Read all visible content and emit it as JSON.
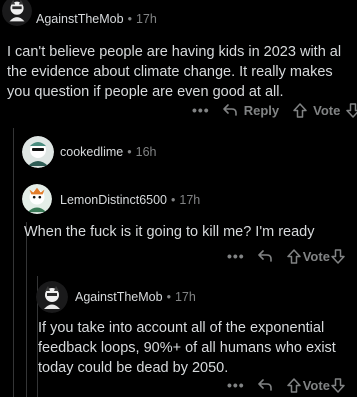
{
  "comments": [
    {
      "username": "AgainstTheMob",
      "age": "17h",
      "lines": [
        "I can't believe people are having kids in 2023 with al",
        "the evidence about climate change. It really makes",
        "you question if people are even good at all."
      ],
      "more": "•••",
      "reply_label": "Reply",
      "vote_label": "Vote"
    },
    {
      "username": "cookedlime",
      "age": "16h",
      "lines": []
    },
    {
      "username": "LemonDistinct6500",
      "age": "17h",
      "lines": [
        "When the fuck is it going to kill me? I'm ready"
      ],
      "more": "•••",
      "vote_label": "Vote"
    },
    {
      "username": "AgainstTheMob",
      "age": "17h",
      "lines": [
        "If you take into account all of the exponential",
        "feedback loops, 90%+ of all humans who exist",
        "today could be dead by 2050."
      ],
      "more": "•••",
      "vote_label": "Vote"
    }
  ],
  "separator": "•",
  "icons": {
    "reply": "reply-arrow-icon",
    "upvote": "upvote-arrow-icon",
    "downvote": "downvote-arrow-icon"
  },
  "colors": {
    "background": "#000000",
    "text": "#d7dadc",
    "meta": "#818384",
    "thread_line": "#343536"
  }
}
